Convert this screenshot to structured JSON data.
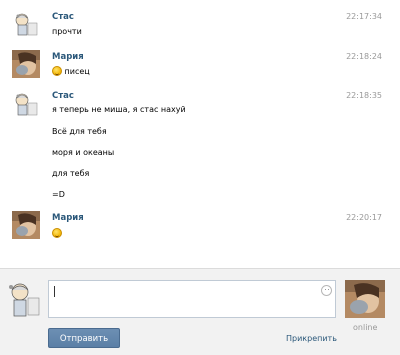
{
  "messages": [
    {
      "author": "Стас",
      "time": "22:17:34",
      "lines": [
        "прочти"
      ]
    },
    {
      "author": "Мария",
      "time": "22:18:24",
      "lines": [
        "писец"
      ],
      "smile": true
    },
    {
      "author": "Стас",
      "time": "22:18:35",
      "lines": [
        "я теперь не миша, я стас нахуй",
        "Всё для тебя",
        "моря и океаны",
        "для тебя",
        "=D"
      ]
    },
    {
      "author": "Мария",
      "time": "22:20:17",
      "lines": [],
      "smile": true
    }
  ],
  "composer": {
    "value": "",
    "send_label": "Отправить",
    "attach_label": "Прикрепить",
    "status": "online"
  },
  "icons": {
    "stas_avatar": "cartoon-character-avatar",
    "maria_avatar": "photo-avatar",
    "emoji": "smile-icon"
  }
}
